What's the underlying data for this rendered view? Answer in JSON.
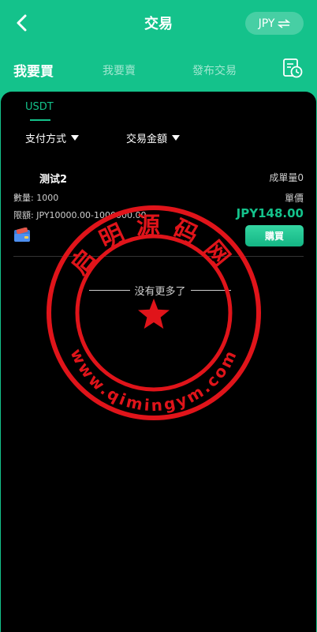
{
  "header": {
    "title": "交易",
    "currency": "JPY"
  },
  "tabs": [
    {
      "label": "我要買"
    },
    {
      "label": "我要賣"
    },
    {
      "label": "發布交易"
    }
  ],
  "coin_tab": "USDT",
  "filters": {
    "payment": "支付方式",
    "amount": "交易金額"
  },
  "listing": {
    "name": "测试2",
    "volume": "成單量0",
    "quantity": "數量: 1000",
    "unit_price_label": "單價",
    "limit": "限額: JPY10000.00-1000000.00",
    "price": "JPY148.00",
    "buy_label": "購買"
  },
  "empty_text": "没有更多了",
  "watermark": {
    "name": "启明源码网",
    "url": "www.qimingym.com",
    "color": "#e0141a"
  }
}
